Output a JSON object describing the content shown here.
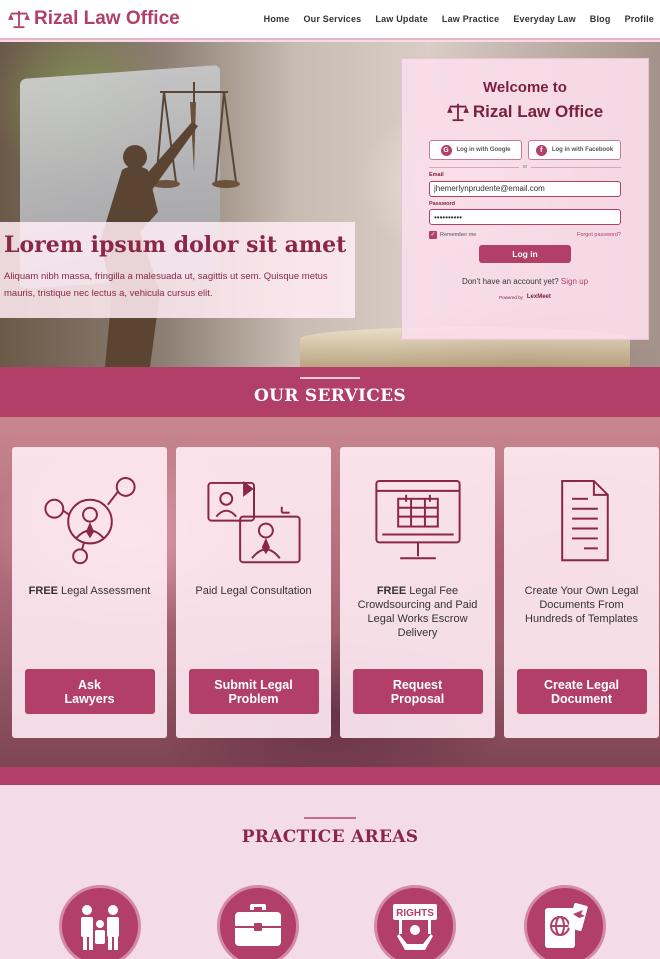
{
  "nav": {
    "brand": "Rizal Law Office",
    "links": [
      "Home",
      "Our Services",
      "Law Update",
      "Law Practice",
      "Everyday Law",
      "Blog",
      "Profile"
    ]
  },
  "hero": {
    "title": "Lorem ipsum dolor sit amet",
    "text": "Aliquam nibh massa, fringilla a malesuada ut, sagittis ut sem. Quisque metus mauris, tristique nec lectus a, vehicula cursus elit."
  },
  "login": {
    "welcome": "Welcome to",
    "brand": "Rizal Law Office",
    "google_label": "Log in with Google",
    "facebook_label": "Log in with Facebook",
    "or": "or",
    "email_label": "Email",
    "email_value": "jhemerlynprudente@email.com",
    "password_label": "Password",
    "password_value": "••••••••••",
    "remember_label": "Remember me",
    "forgot_label": "Forgot password?",
    "login_button": "Log in",
    "no_account": "Don't have an account yet?",
    "signup_link": "Sign up",
    "powered_by": "Powered by",
    "powered_brand": "LexMeet"
  },
  "services": {
    "heading": "OUR SERVICES",
    "cards": [
      {
        "text_bold": "FREE",
        "text": " Legal Assessment",
        "button": "Ask\nLawyers",
        "icon": "network-people-icon"
      },
      {
        "text_bold": "",
        "text": "Paid Legal Consultation",
        "button": "Submit Legal\nProblem",
        "icon": "video-consultation-icon"
      },
      {
        "text_bold": "FREE",
        "text": " Legal Fee Crowdsourcing and Paid Legal Works Escrow Delivery",
        "button": "Request\nProposal",
        "icon": "computer-calendar-icon"
      },
      {
        "text_bold": "",
        "text": "Create Your Own Legal Documents From Hundreds of Templates",
        "button": "Create Legal\nDocument",
        "icon": "document-icon"
      }
    ]
  },
  "practice": {
    "heading": "PRACTICE AREAS",
    "rights_label": "RIGHTS",
    "icons": [
      "family-icon",
      "briefcase-icon",
      "rights-protest-icon",
      "passport-icon"
    ]
  },
  "colors": {
    "accent": "#b13f68",
    "dark_accent": "#8a2749",
    "page_bg": "#f3dbe7",
    "card_bg": "#ffecf4"
  }
}
